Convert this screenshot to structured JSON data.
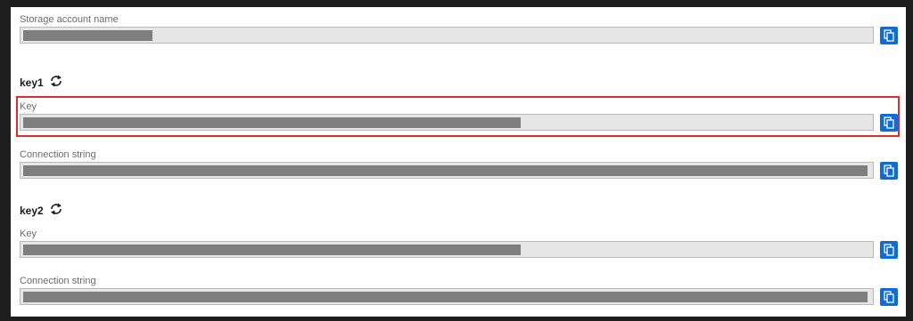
{
  "storage": {
    "label": "Storage account name"
  },
  "key1": {
    "title": "key1",
    "key_label": "Key",
    "connection_label": "Connection string"
  },
  "key2": {
    "title": "key2",
    "key_label": "Key",
    "connection_label": "Connection string"
  },
  "icons": {
    "copy": "copy-icon",
    "refresh": "refresh-icon"
  },
  "colors": {
    "accent": "#0f6cd6",
    "highlight": "#d9302c",
    "masked_value": "#7f7f7f"
  }
}
